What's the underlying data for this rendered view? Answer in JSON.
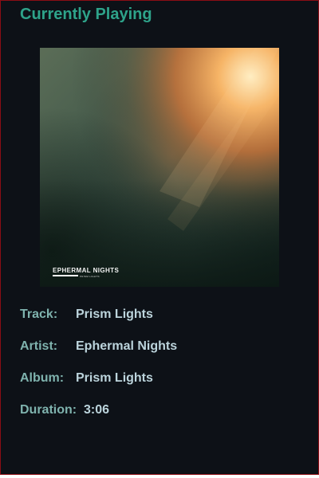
{
  "player": {
    "heading": "Currently Playing",
    "cover_art": {
      "title_text": "EPHERMAL NIGHTS",
      "subtitle_text": "PRISM LIGHTS"
    },
    "track": {
      "label": "Track:",
      "value": "Prism Lights"
    },
    "artist": {
      "label": "Artist:",
      "value": "Ephermal Nights"
    },
    "album": {
      "label": "Album:",
      "value": "Prism Lights"
    },
    "duration": {
      "label": "Duration:",
      "value": "3:06"
    }
  },
  "colors": {
    "background": "#0d1117",
    "border": "#8b0d14",
    "heading": "#2ea38a",
    "label": "#7fb3ae",
    "value": "#bcd4dc"
  }
}
